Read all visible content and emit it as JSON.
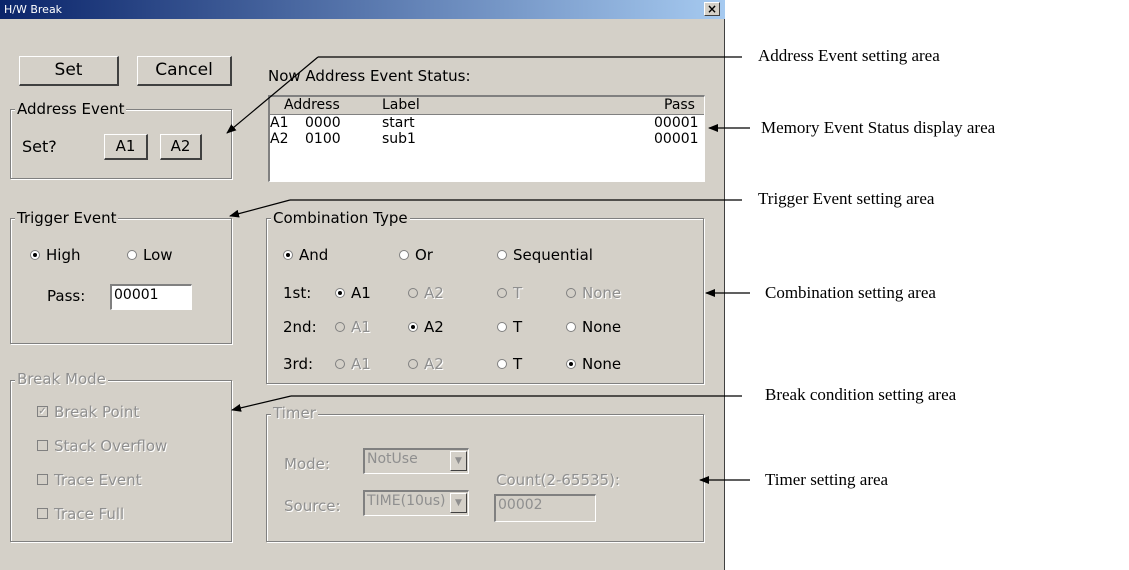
{
  "window": {
    "title": "H/W Break",
    "close_label": "×"
  },
  "buttons": {
    "set": "Set",
    "cancel": "Cancel"
  },
  "address_event": {
    "title": "Address Event",
    "set_label": "Set?",
    "a1": "A1",
    "a2": "A2"
  },
  "status": {
    "label": "Now Address Event Status:",
    "columns": [
      "Address",
      "Label",
      "Pass"
    ],
    "rows": [
      {
        "id": "A1",
        "address": "0000",
        "label": "start",
        "pass": "00001"
      },
      {
        "id": "A2",
        "address": "0100",
        "label": "sub1",
        "pass": "00001"
      }
    ]
  },
  "trigger_event": {
    "title": "Trigger Event",
    "high": "High",
    "low": "Low",
    "selected": "High",
    "pass_label": "Pass:",
    "pass_value": "00001"
  },
  "combination": {
    "title": "Combination Type",
    "types": [
      "And",
      "Or",
      "Sequential"
    ],
    "selected_type": "And",
    "row_labels": [
      "1st:",
      "2nd:",
      "3rd:"
    ],
    "options": [
      "A1",
      "A2",
      "T",
      "None"
    ],
    "selected": [
      "A1",
      "A2",
      "None"
    ]
  },
  "break_mode": {
    "title": "Break Mode",
    "items": [
      {
        "label": "Break Point",
        "checked": true
      },
      {
        "label": "Stack Overflow",
        "checked": false
      },
      {
        "label": "Trace Event",
        "checked": false
      },
      {
        "label": "Trace Full",
        "checked": false
      }
    ]
  },
  "timer": {
    "title": "Timer",
    "mode_label": "Mode:",
    "mode_value": "NotUse",
    "source_label": "Source:",
    "source_value": "TIME(10us)",
    "count_label": "Count(2-65535):",
    "count_value": "00002"
  },
  "annotations": {
    "address_event": "Address Event setting area",
    "memory_status": "Memory Event Status display area",
    "trigger_event": "Trigger Event setting area",
    "combination": "Combination setting area",
    "break_condition": "Break condition setting area",
    "timer": "Timer setting area"
  }
}
